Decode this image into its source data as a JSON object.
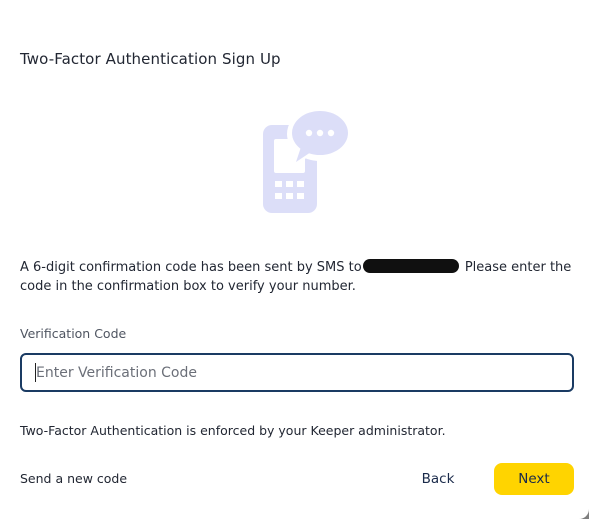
{
  "dialog": {
    "title": "Two-Factor Authentication Sign Up",
    "message_prefix": "A 6-digit confirmation code has been sent by SMS to",
    "message_suffix": " Please enter the code in the confirmation box to verify your number.",
    "field_label": "Verification Code",
    "input_value": "",
    "input_placeholder": "Enter Verification Code",
    "enforced_note": "Two-Factor Authentication is enforced by your Keeper administrator.",
    "send_new_code_label": "Send a new code",
    "back_label": "Back",
    "next_label": "Next"
  },
  "icons": {
    "illustration": "phone-sms-chat-icon"
  },
  "colors": {
    "accent_yellow": "#ffd400",
    "input_border": "#1a3b63",
    "illustration": "#dcdef8",
    "text": "#222733"
  }
}
